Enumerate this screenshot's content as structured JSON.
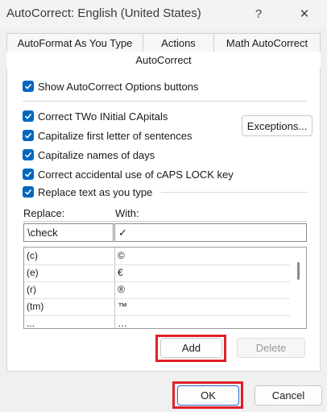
{
  "window": {
    "title": "AutoCorrect: English (United States)",
    "help_glyph": "?",
    "close_glyph": "✕"
  },
  "tabs": [
    {
      "label": "AutoFormat As You Type"
    },
    {
      "label": "Actions"
    },
    {
      "label": "Math AutoCorrect"
    },
    {
      "label": "AutoCorrect",
      "active": true
    }
  ],
  "options": {
    "show_buttons": {
      "label": "Show AutoCorrect Options buttons",
      "checked": true
    },
    "correct_two_initials": {
      "label": "Correct TWo INitial CApitals",
      "checked": true
    },
    "capitalize_first": {
      "label": "Capitalize first letter of sentences",
      "checked": true
    },
    "capitalize_days": {
      "label": "Capitalize names of days",
      "checked": true
    },
    "caps_lock": {
      "label": "Correct accidental use of cAPS LOCK key",
      "checked": true
    },
    "replace_text": {
      "label": "Replace text as you type",
      "checked": true
    }
  },
  "exceptions_button": "Exceptions...",
  "replace_label": "Replace:",
  "with_label": "With:",
  "replace_value": "\\check",
  "with_value": "✓",
  "list_rows": [
    {
      "replace": "(c)",
      "with": "©"
    },
    {
      "replace": "(e)",
      "with": "€"
    },
    {
      "replace": "(r)",
      "with": "®"
    },
    {
      "replace": "(tm)",
      "with": "™"
    },
    {
      "replace": "...",
      "with": "…"
    }
  ],
  "add_button": "Add",
  "delete_button": "Delete",
  "ok_button": "OK",
  "cancel_button": "Cancel",
  "colors": {
    "accent": "#0067c0",
    "highlight": "#e0202a"
  }
}
